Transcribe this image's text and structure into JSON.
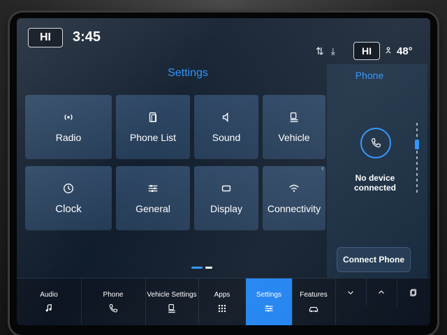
{
  "status": {
    "left_hi": "HI",
    "time": "3:45",
    "right_hi": "HI",
    "temperature": "48°"
  },
  "settings": {
    "title": "Settings",
    "tiles": [
      {
        "label": "Radio",
        "icon": "radio-signal-icon"
      },
      {
        "label": "Phone List",
        "icon": "phone-list-icon"
      },
      {
        "label": "Sound",
        "icon": "speaker-icon"
      },
      {
        "label": "Vehicle",
        "icon": "vehicle-settings-icon"
      },
      {
        "label": "Clock",
        "icon": "clock-icon"
      },
      {
        "label": "General",
        "icon": "sliders-icon"
      },
      {
        "label": "Display",
        "icon": "display-icon"
      },
      {
        "label": "Connectivity",
        "icon": "wifi-icon"
      }
    ]
  },
  "phone_panel": {
    "title": "Phone",
    "status": "No device connected",
    "connect_label": "Connect Phone"
  },
  "bottom_nav": {
    "audio": "Audio",
    "phone": "Phone",
    "vehicle_settings": "Vehicle Settings",
    "apps": "Apps",
    "settings": "Settings",
    "features": "Features"
  },
  "colors": {
    "accent": "#2f95ff",
    "active_tab": "#1f82f0",
    "tile": "#2f4866"
  }
}
